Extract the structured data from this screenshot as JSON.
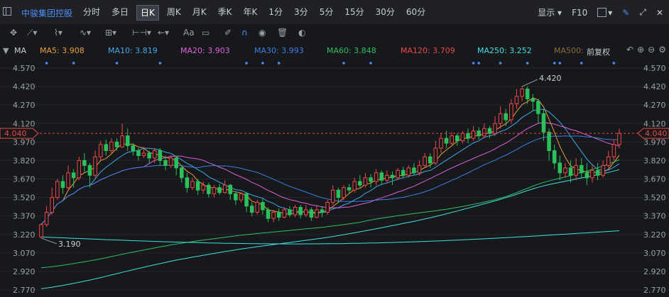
{
  "toolbar": {
    "stock_name": "中骏集团控股",
    "periods": [
      "分时",
      "多日",
      "日K",
      "周K",
      "月K",
      "季K",
      "年K",
      "1分",
      "3分",
      "5分",
      "15分",
      "30分",
      "60分"
    ],
    "active_period": "日K",
    "display_label": "显示",
    "f10_label": "F10"
  },
  "drawing_tools": {
    "text_tool_label": "Aa"
  },
  "indicator_bar": {
    "main_label": "MA",
    "items": [
      {
        "label": "MA5: 3.908",
        "color": "#e7a038"
      },
      {
        "label": "MA10: 3.819",
        "color": "#3fa9e8"
      },
      {
        "label": "MA20: 3.903",
        "color": "#e060d8"
      },
      {
        "label": "MA30: 3.993",
        "color": "#3b7fe0"
      },
      {
        "label": "MA60: 3.848",
        "color": "#2fbf60"
      },
      {
        "label": "MA120: 3.709",
        "color": "#e84848"
      },
      {
        "label": "MA250: 3.252",
        "color": "#3fe0e0"
      },
      {
        "label": "MA500:",
        "color": "#8a6d3a"
      }
    ],
    "adjust_label": "前复权"
  },
  "chart_data": {
    "type": "candlestick",
    "y_ticks": [
      "4.570",
      "4.420",
      "4.270",
      "4.120",
      "3.970",
      "3.820",
      "3.670",
      "3.520",
      "3.370",
      "3.220",
      "3.070",
      "2.920",
      "2.770"
    ],
    "ylim": [
      2.77,
      4.57
    ],
    "current_price": "4.040",
    "annotations": {
      "high": "4.420",
      "low": "3.190"
    },
    "candles": [
      [
        3.2,
        3.3,
        3.31,
        3.19
      ],
      [
        3.3,
        3.4,
        3.45,
        3.28
      ],
      [
        3.4,
        3.52,
        3.6,
        3.38
      ],
      [
        3.52,
        3.65,
        3.67,
        3.5
      ],
      [
        3.65,
        3.6,
        3.7,
        3.55
      ],
      [
        3.6,
        3.72,
        3.78,
        3.58
      ],
      [
        3.72,
        3.68,
        3.75,
        3.6
      ],
      [
        3.68,
        3.82,
        3.85,
        3.66
      ],
      [
        3.82,
        3.78,
        3.88,
        3.72
      ],
      [
        3.78,
        3.7,
        3.8,
        3.6
      ],
      [
        3.7,
        3.85,
        3.9,
        3.68
      ],
      [
        3.85,
        3.95,
        3.98,
        3.82
      ],
      [
        3.95,
        3.9,
        3.99,
        3.86
      ],
      [
        3.9,
        3.97,
        4.0,
        3.88
      ],
      [
        3.97,
        3.93,
        4.0,
        3.9
      ],
      [
        3.93,
        4.02,
        4.12,
        3.92
      ],
      [
        4.02,
        3.94,
        4.08,
        3.9
      ],
      [
        3.94,
        3.9,
        3.96,
        3.86
      ],
      [
        3.9,
        3.86,
        3.92,
        3.82
      ],
      [
        3.86,
        3.88,
        3.93,
        3.84
      ],
      [
        3.88,
        3.84,
        3.9,
        3.8
      ],
      [
        3.84,
        3.9,
        3.92,
        3.8
      ],
      [
        3.9,
        3.82,
        3.92,
        3.78
      ],
      [
        3.82,
        3.78,
        3.86,
        3.74
      ],
      [
        3.78,
        3.84,
        3.86,
        3.76
      ],
      [
        3.84,
        3.76,
        3.86,
        3.7
      ],
      [
        3.76,
        3.68,
        3.78,
        3.64
      ],
      [
        3.68,
        3.6,
        3.72,
        3.56
      ],
      [
        3.6,
        3.65,
        3.68,
        3.58
      ],
      [
        3.65,
        3.58,
        3.67,
        3.54
      ],
      [
        3.58,
        3.62,
        3.65,
        3.55
      ],
      [
        3.62,
        3.55,
        3.64,
        3.52
      ],
      [
        3.55,
        3.6,
        3.62,
        3.52
      ],
      [
        3.6,
        3.56,
        3.63,
        3.54
      ],
      [
        3.56,
        3.62,
        3.66,
        3.55
      ],
      [
        3.62,
        3.55,
        3.63,
        3.5
      ],
      [
        3.55,
        3.5,
        3.57,
        3.46
      ],
      [
        3.5,
        3.55,
        3.56,
        3.48
      ],
      [
        3.55,
        3.45,
        3.56,
        3.4
      ],
      [
        3.45,
        3.4,
        3.48,
        3.37
      ],
      [
        3.4,
        3.48,
        3.5,
        3.38
      ],
      [
        3.48,
        3.42,
        3.51,
        3.38
      ],
      [
        3.42,
        3.35,
        3.44,
        3.32
      ],
      [
        3.35,
        3.4,
        3.42,
        3.32
      ],
      [
        3.4,
        3.36,
        3.43,
        3.33
      ],
      [
        3.36,
        3.42,
        3.44,
        3.35
      ],
      [
        3.42,
        3.38,
        3.45,
        3.36
      ],
      [
        3.38,
        3.44,
        3.46,
        3.36
      ],
      [
        3.44,
        3.38,
        3.46,
        3.35
      ],
      [
        3.38,
        3.42,
        3.46,
        3.36
      ],
      [
        3.42,
        3.36,
        3.44,
        3.33
      ],
      [
        3.36,
        3.42,
        3.46,
        3.35
      ],
      [
        3.42,
        3.4,
        3.45,
        3.36
      ],
      [
        3.4,
        3.48,
        3.5,
        3.38
      ],
      [
        3.48,
        3.58,
        3.62,
        3.46
      ],
      [
        3.58,
        3.52,
        3.6,
        3.48
      ],
      [
        3.52,
        3.6,
        3.62,
        3.5
      ],
      [
        3.6,
        3.58,
        3.63,
        3.55
      ],
      [
        3.58,
        3.65,
        3.68,
        3.56
      ],
      [
        3.65,
        3.62,
        3.7,
        3.6
      ],
      [
        3.62,
        3.68,
        3.72,
        3.6
      ],
      [
        3.68,
        3.65,
        3.71,
        3.6
      ],
      [
        3.65,
        3.72,
        3.75,
        3.62
      ],
      [
        3.72,
        3.66,
        3.74,
        3.63
      ],
      [
        3.66,
        3.7,
        3.74,
        3.64
      ],
      [
        3.7,
        3.68,
        3.73,
        3.62
      ],
      [
        3.68,
        3.74,
        3.76,
        3.66
      ],
      [
        3.74,
        3.7,
        3.77,
        3.68
      ],
      [
        3.7,
        3.76,
        3.78,
        3.68
      ],
      [
        3.76,
        3.72,
        3.8,
        3.7
      ],
      [
        3.72,
        3.78,
        3.82,
        3.7
      ],
      [
        3.78,
        3.85,
        3.88,
        3.76
      ],
      [
        3.85,
        3.8,
        3.88,
        3.76
      ],
      [
        3.8,
        3.92,
        3.98,
        3.78
      ],
      [
        3.92,
        4.0,
        4.04,
        3.88
      ],
      [
        4.0,
        3.96,
        4.06,
        3.92
      ],
      [
        3.96,
        4.02,
        4.05,
        3.94
      ],
      [
        4.02,
        3.98,
        4.04,
        3.94
      ],
      [
        3.98,
        4.04,
        4.06,
        3.96
      ],
      [
        4.04,
        4.0,
        4.08,
        3.96
      ],
      [
        4.0,
        4.06,
        4.1,
        3.98
      ],
      [
        4.06,
        4.02,
        4.09,
        3.99
      ],
      [
        4.02,
        4.08,
        4.12,
        4.0
      ],
      [
        4.08,
        4.04,
        4.1,
        4.0
      ],
      [
        4.04,
        4.12,
        4.18,
        4.02
      ],
      [
        4.12,
        4.2,
        4.26,
        4.08
      ],
      [
        4.2,
        4.15,
        4.24,
        4.1
      ],
      [
        4.15,
        4.28,
        4.32,
        4.12
      ],
      [
        4.28,
        4.34,
        4.4,
        4.24
      ],
      [
        4.34,
        4.4,
        4.42,
        4.3
      ],
      [
        4.4,
        4.32,
        4.42,
        4.28
      ],
      [
        4.32,
        4.3,
        4.36,
        4.22
      ],
      [
        4.3,
        4.2,
        4.32,
        4.12
      ],
      [
        4.2,
        4.05,
        4.24,
        3.98
      ],
      [
        4.05,
        3.9,
        4.08,
        3.82
      ],
      [
        3.9,
        3.8,
        3.95,
        3.75
      ],
      [
        3.8,
        3.72,
        3.86,
        3.66
      ],
      [
        3.72,
        3.76,
        3.8,
        3.68
      ],
      [
        3.76,
        3.7,
        3.82,
        3.64
      ],
      [
        3.7,
        3.78,
        3.84,
        3.66
      ],
      [
        3.78,
        3.72,
        3.84,
        3.68
      ],
      [
        3.72,
        3.68,
        3.8,
        3.62
      ],
      [
        3.68,
        3.74,
        3.78,
        3.64
      ],
      [
        3.74,
        3.7,
        3.8,
        3.66
      ],
      [
        3.7,
        3.78,
        3.82,
        3.68
      ],
      [
        3.78,
        3.85,
        3.9,
        3.76
      ],
      [
        3.85,
        3.95,
        3.99,
        3.82
      ],
      [
        3.95,
        4.04,
        4.08,
        3.92
      ]
    ]
  }
}
